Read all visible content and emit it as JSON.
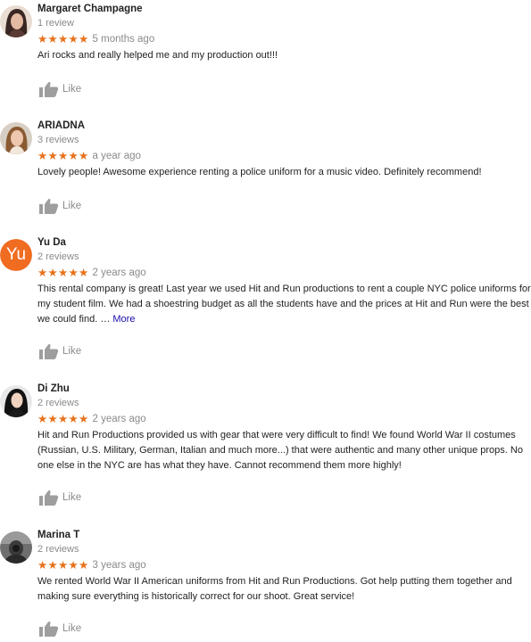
{
  "like_label": "Like",
  "more_label": "More",
  "reviews": [
    {
      "name": "Margaret Champagne",
      "count": "1 review",
      "stars": "★★★★★",
      "date": "5 months ago",
      "text": "Ari rocks and really helped me and my production out!!!",
      "avatar": "profile-photo"
    },
    {
      "name": "ARIADNA",
      "count": "3 reviews",
      "stars": "★★★★★",
      "date": "a year ago",
      "text": "Lovely people! Awesome experience renting a police uniform for a music video. Definitely recommend!",
      "avatar": "profile-photo"
    },
    {
      "name": "Yu Da",
      "count": "2 reviews",
      "stars": "★★★★★",
      "date": "2 years ago",
      "text": "This rental company is great! Last year we used Hit and Run productions to rent a couple NYC police uniforms for my student film. We had a shoestring budget as all the students have and the prices at Hit and Run were the best we could find. …",
      "avatar_initials": "Yu"
    },
    {
      "name": "Di Zhu",
      "count": "2 reviews",
      "stars": "★★★★★",
      "date": "2 years ago",
      "text": "Hit and Run Productions provided us with gear that were very difficult to find! We found World War II costumes (Russian, U.S. Military, German, Italian and much more...) that were authentic and many other unique props. No one else in the NYC are has what they have. Cannot recommend them more highly!",
      "avatar": "profile-photo"
    },
    {
      "name": "Marina T",
      "count": "2 reviews",
      "stars": "★★★★★",
      "date": "3 years ago",
      "text": "We rented World War II American uniforms from Hit and Run Productions. Got help putting them together and making sure everything is historically correct for our shoot. Great service!",
      "avatar": "profile-photo"
    }
  ],
  "colors": {
    "star": "#e7711b",
    "avatar_letter_bg": "#ef6c21",
    "muted_text": "#8a8a8a",
    "link": "#1a0dab",
    "like_icon": "#9e9e9e"
  },
  "rating_out_of_5": 5
}
